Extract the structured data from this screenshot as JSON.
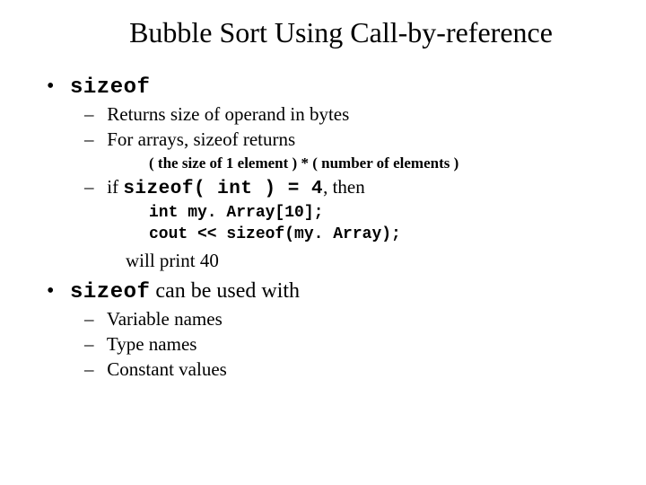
{
  "title": "Bubble Sort Using Call-by-reference",
  "b1": {
    "code": "sizeof",
    "s1": "Returns size of operand in bytes",
    "s2a": "For arrays, sizeof returns",
    "formula": "( the size of 1 element ) * ( number of elements )",
    "s3a": "if ",
    "s3code": "sizeof( int ) = 4",
    "s3b": ", then",
    "code1": "int my. Array[10];",
    "code2": "cout << sizeof(my. Array);",
    "wp": "will print 40"
  },
  "b2": {
    "code": "sizeof",
    "text": " can be used with",
    "s1": "Variable names",
    "s2": "Type names",
    "s3": "Constant values"
  }
}
